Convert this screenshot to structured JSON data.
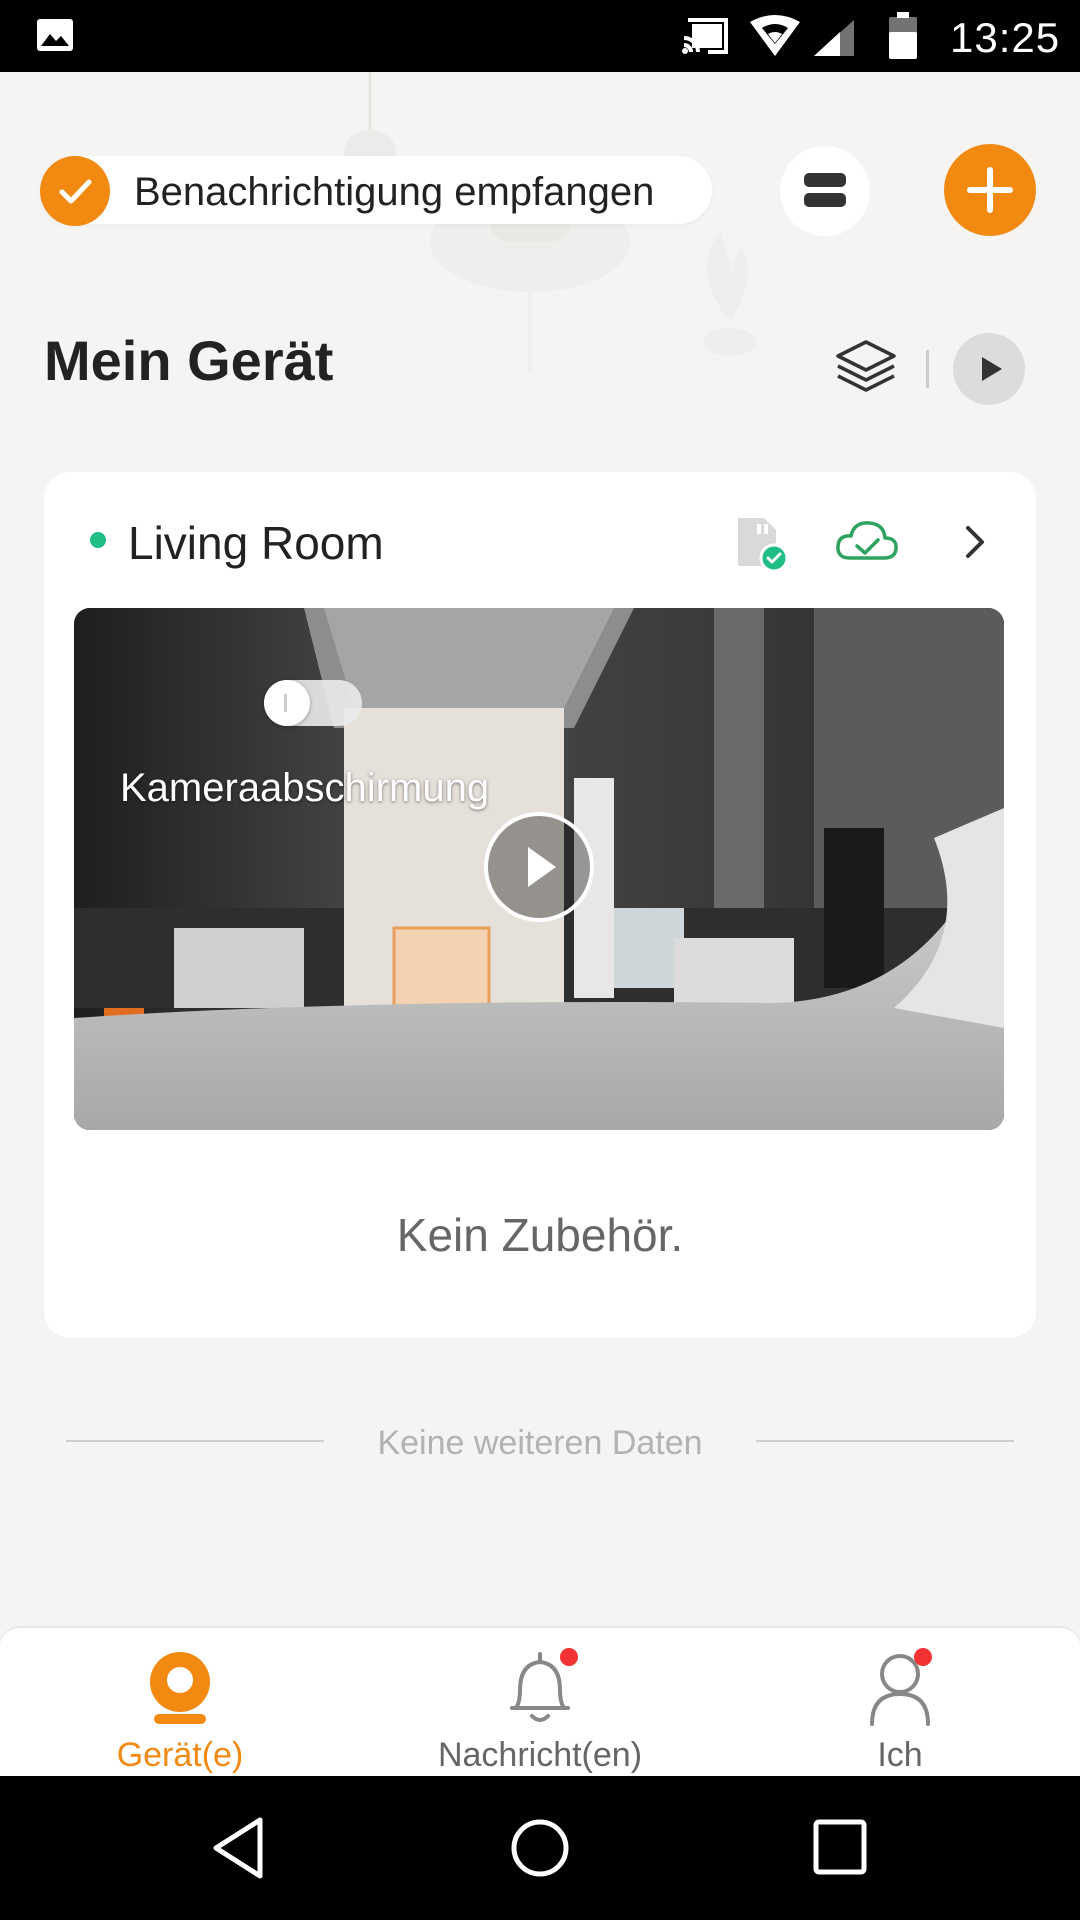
{
  "status_bar": {
    "time": "13:25",
    "icons": [
      "gallery-icon",
      "cast-icon",
      "wifi-icon",
      "signal-icon",
      "battery-icon"
    ]
  },
  "header": {
    "notification_label": "Benachrichtigung empfangen",
    "menu_icon": "list-icon",
    "add_icon": "plus-icon"
  },
  "page": {
    "title": "Mein Gerät"
  },
  "device_card": {
    "name": "Living Room",
    "status": "online",
    "shield_label": "Kameraabschirmung",
    "shield_enabled": false,
    "empty_accessory_text": "Kein Zubehör."
  },
  "list_footer": {
    "text": "Keine weiteren Daten"
  },
  "bottom_nav": {
    "items": [
      {
        "label": "Gerät(e)",
        "icon": "camera-icon",
        "active": true,
        "badge": false
      },
      {
        "label": "Nachricht(en)",
        "icon": "bell-icon",
        "active": false,
        "badge": true
      },
      {
        "label": "Ich",
        "icon": "person-icon",
        "active": false,
        "badge": true
      }
    ]
  },
  "colors": {
    "accent": "#f28a12",
    "online": "#1fbe85",
    "cloud": "#2ea35f",
    "badge": "#f23333"
  }
}
